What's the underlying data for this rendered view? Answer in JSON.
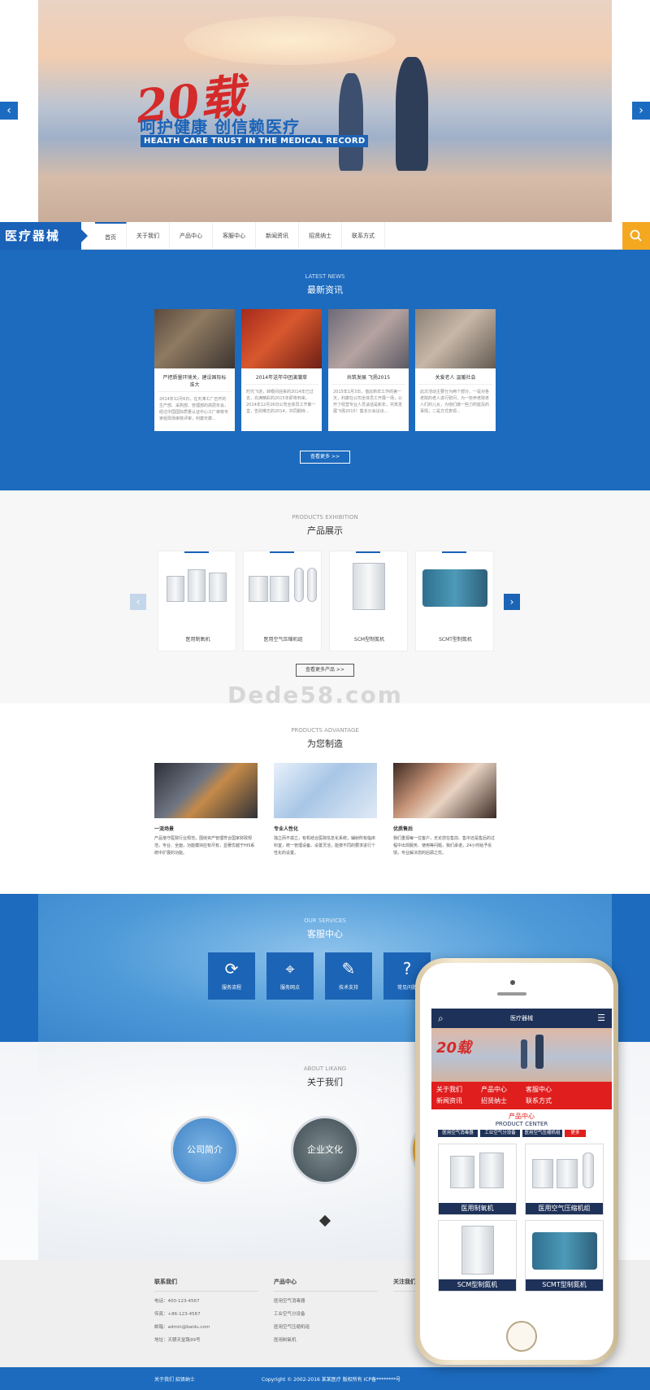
{
  "banner": {
    "big_number": "20载",
    "slogan": "呵护健康  创信赖医疗",
    "slogan_en": "HEALTH CARE TRUST IN THE MEDICAL RECORD",
    "prev_icon": "chevron-left-icon",
    "next_icon": "chevron-right-icon"
  },
  "nav": {
    "logo": "医疗器械",
    "items": [
      "首页",
      "关于我们",
      "产品中心",
      "客服中心",
      "新闻资讯",
      "招贤纳士",
      "联系方式"
    ],
    "search_icon": "search-icon"
  },
  "news": {
    "title_en": "LATEST NEWS",
    "title_cn": "最新资讯",
    "cards": [
      {
        "title": "严把质量环境关，建设国际标准大",
        "desc": "2014年12月6日，在天津工厂召开的生产部、采购部、管理部的高层年会，经过中国国际质量认证中心工厂审核专家组现场审核评审，利康天康..."
      },
      {
        "title": "2014年送年中团演蒲草",
        "desc": "时光飞逝，转眼间迎来的2014年已过去，充满精彩的2015年即将到来。2014年12月26日公司全体员工齐聚一堂，告别难忘的2014，共同期待..."
      },
      {
        "title": "共筑发展 飞扬2015",
        "desc": "2015年1月3日，值此新年工作的第一天，利康在公司全体员工开展一场，公开了经营专业人员谈话是新年，共筑发展飞扬2015！集长沙会议出..."
      },
      {
        "title": "关爱老人 温暖社会",
        "desc": "此次活动主要分为两个部分，一是对各老院的老人进行慰问，为一些养老院老人们的儿女，为他们做一些力所能及的事情；二是方式表现..."
      }
    ],
    "more_button": "查看更多 >>"
  },
  "products": {
    "title_en": "PRODUCTS EXHIBITION",
    "title_cn": "产品展示",
    "items": [
      "医用制氧机",
      "医用空气压缩机组",
      "SCM型制氮机",
      "SCMT型制氮机"
    ],
    "more_button": "查看更多产品 >>"
  },
  "watermark": "Dede58.com",
  "advantage": {
    "title_en": "PRODUCTS ADVANTAGE",
    "title_cn": "为您制造",
    "items": [
      {
        "title": "一流场景",
        "desc": "产品恪守医院行业规范，围绕资产管理符合国家财政规范，专业、全面，功能模块应有尽有，显著优越于HIS系统中扩展的功能。"
      },
      {
        "title": "专业人性化",
        "desc": "独立而不孤立，有机结合医院信息化系统，辅射所有临床科室，统一管理设备。设置灵活，能按不同的要求进行个性化的设置。"
      },
      {
        "title": "优质售后",
        "desc": "我们重视每一位客户，无论您在售前、售中还是售后的过程中出现服务、使用等问题，我们承诺，24小时给予反馈，专业解决您的后顾之忧。"
      }
    ]
  },
  "service": {
    "title_en": "OUR SERVICES",
    "title_cn": "客服中心",
    "items": [
      {
        "label": "服务流程",
        "icon": "refresh-icon"
      },
      {
        "label": "服务网点",
        "icon": "location-pin-icon"
      },
      {
        "label": "技术支持",
        "icon": "wrench-icon"
      },
      {
        "label": "常见问题",
        "icon": "question-icon"
      }
    ]
  },
  "about": {
    "title_en": "ABOUT LIKANG",
    "title_cn": "关于我们",
    "circles": [
      "公司简介",
      "企业文化"
    ]
  },
  "footer": {
    "contact": {
      "heading": "联系我们",
      "lines": [
        "电话：400-123-4567",
        "传真：+86-123-4567",
        "邮箱：admin@baidu.com",
        "地址：天朝天堂路99号"
      ]
    },
    "product_center": {
      "heading": "产品中心",
      "lines": [
        "医用空气消毒器",
        "工业空气分设备",
        "医用空气压缩机组",
        "医用制氧机"
      ]
    },
    "follow": {
      "heading": "关注我们"
    },
    "bar_left": "关于我们    招贤纳士",
    "copyright": "Copyright © 2002-2016 某某医疗 版权所有   ICP备********号"
  },
  "phone": {
    "header_title": "医疗器械",
    "menu": [
      "关于我们",
      "产品中心",
      "客服中心",
      "新闻资讯",
      "招贤纳士",
      "联系方式"
    ],
    "section_title": "产品中心",
    "section_en": "PRODUCT CENTER",
    "tabs": [
      "医用空气消毒器",
      "工业空气分设备",
      "医用空气压缩机组"
    ],
    "tab_more": "更多",
    "items": [
      "医用制氧机",
      "医用空气压缩机组",
      "SCM型制氮机",
      "SCMT型制氮机"
    ]
  },
  "colors": {
    "primary_blue": "#1c6bbf",
    "accent_orange": "#f4a81f",
    "phone_red": "#e01e1e",
    "phone_navy": "#1e3158"
  }
}
